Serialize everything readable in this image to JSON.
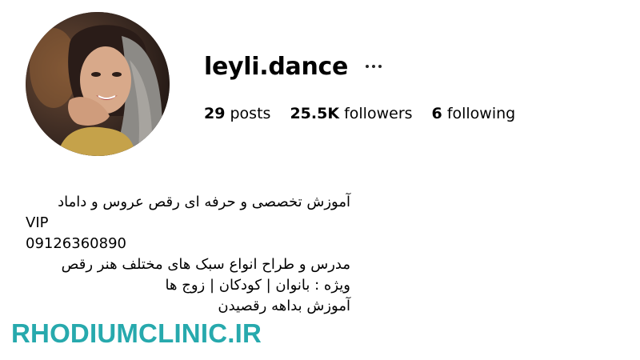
{
  "profile": {
    "username": "leyli.dance",
    "more_icon": "more-horizontal-icon",
    "avatar_icon": "profile-avatar"
  },
  "stats": {
    "posts_count": "29",
    "posts_label": "posts",
    "followers_count": "25.5K",
    "followers_label": "followers",
    "following_count": "6",
    "following_label": "following"
  },
  "bio": {
    "lines": [
      "آموزش تخصصی و حرفه ای رقص عروس و داماد",
      "VIP",
      "09126360890",
      "مدرس و طراح انواع سبک های مختلف هنر رقص",
      "ویژه : بانوان | کودکان | زوج ها",
      "آموزش بداهه رقصیدن"
    ]
  },
  "watermark": {
    "text": "RHODIUMCLINIC.IR",
    "color": "#27a9ad"
  }
}
